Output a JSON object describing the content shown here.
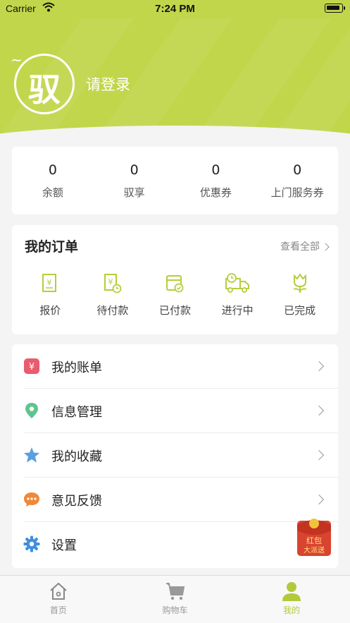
{
  "status_bar": {
    "carrier": "Carrier",
    "time": "7:24 PM"
  },
  "header": {
    "avatar_glyph": "驭",
    "login_text": "请登录",
    "accent_color": "#c1d64a"
  },
  "stats": [
    {
      "value": "0",
      "label": "余额"
    },
    {
      "value": "0",
      "label": "驭享"
    },
    {
      "value": "0",
      "label": "优惠券"
    },
    {
      "value": "0",
      "label": "上门服务券"
    }
  ],
  "orders": {
    "title": "我的订单",
    "view_all": "查看全部",
    "items": [
      {
        "label": "报价",
        "icon": "quote-icon"
      },
      {
        "label": "待付款",
        "icon": "pending-payment-icon"
      },
      {
        "label": "已付款",
        "icon": "paid-icon"
      },
      {
        "label": "进行中",
        "icon": "delivery-truck-icon"
      },
      {
        "label": "已完成",
        "icon": "tulip-icon"
      }
    ]
  },
  "menu": [
    {
      "label": "我的账单",
      "icon": "bill-icon",
      "color": "#e85c6e"
    },
    {
      "label": "信息管理",
      "icon": "location-pin-icon",
      "color": "#5ec48f"
    },
    {
      "label": "我的收藏",
      "icon": "star-icon",
      "color": "#5b9fe0"
    },
    {
      "label": "意见反馈",
      "icon": "chat-bubble-icon",
      "color": "#f0883a"
    },
    {
      "label": "设置",
      "icon": "gear-icon",
      "color": "#3f8ee0"
    }
  ],
  "red_packet": {
    "line1": "红包",
    "line2": "大派送"
  },
  "tabbar": [
    {
      "label": "首页",
      "icon": "home-icon",
      "active": false
    },
    {
      "label": "购物车",
      "icon": "cart-icon",
      "active": false
    },
    {
      "label": "我的",
      "icon": "profile-icon",
      "active": true
    }
  ]
}
